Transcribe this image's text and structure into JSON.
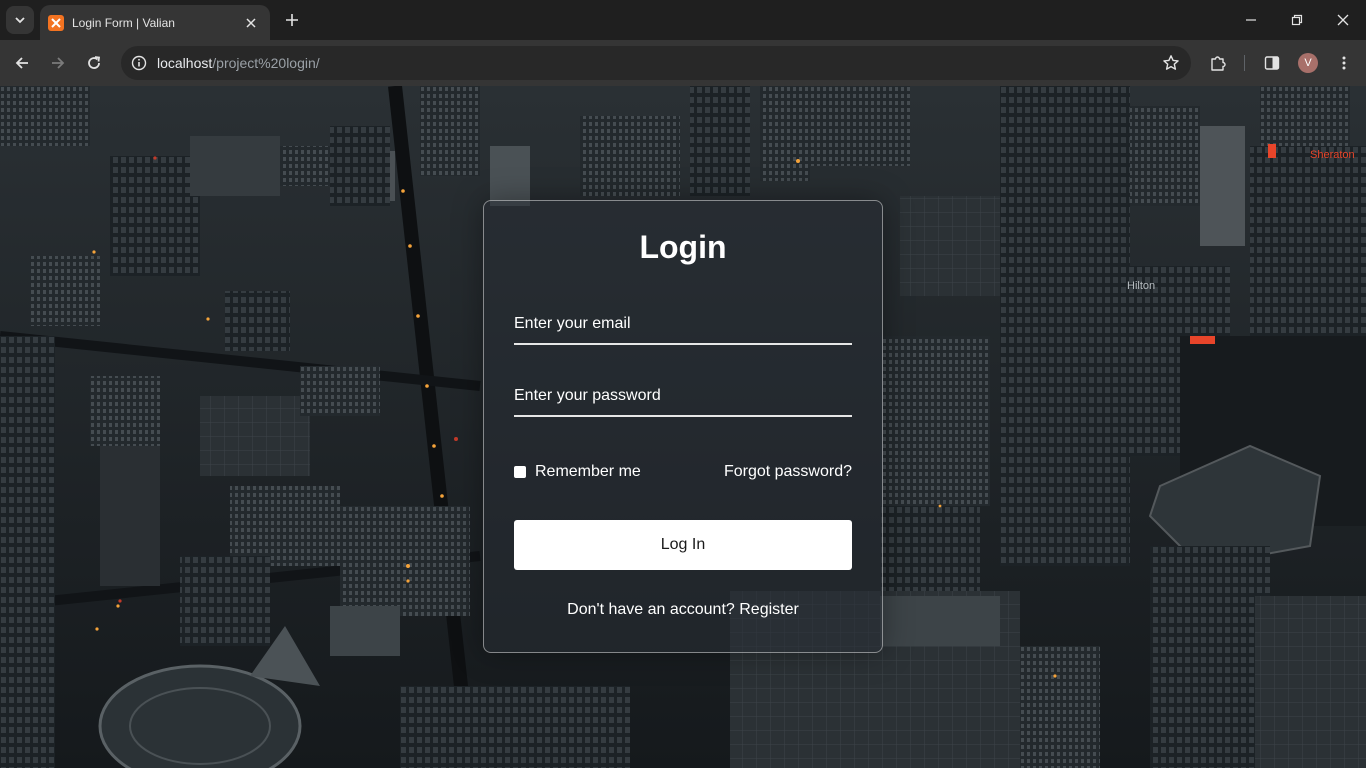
{
  "browser": {
    "tab_title": "Login Form | Valian",
    "url_host": "localhost",
    "url_path": "/project%20login/",
    "profile_initial": "V",
    "accent": "#f37321"
  },
  "background": {
    "sign_text": "Sheraton",
    "building_text": "Hilton"
  },
  "login": {
    "title": "Login",
    "email_placeholder": "Enter your email",
    "password_placeholder": "Enter your password",
    "remember_label": "Remember me",
    "forgot_label": "Forgot password?",
    "button_label": "Log In",
    "register_prompt": "Don't have an account?",
    "register_link": "Register"
  }
}
